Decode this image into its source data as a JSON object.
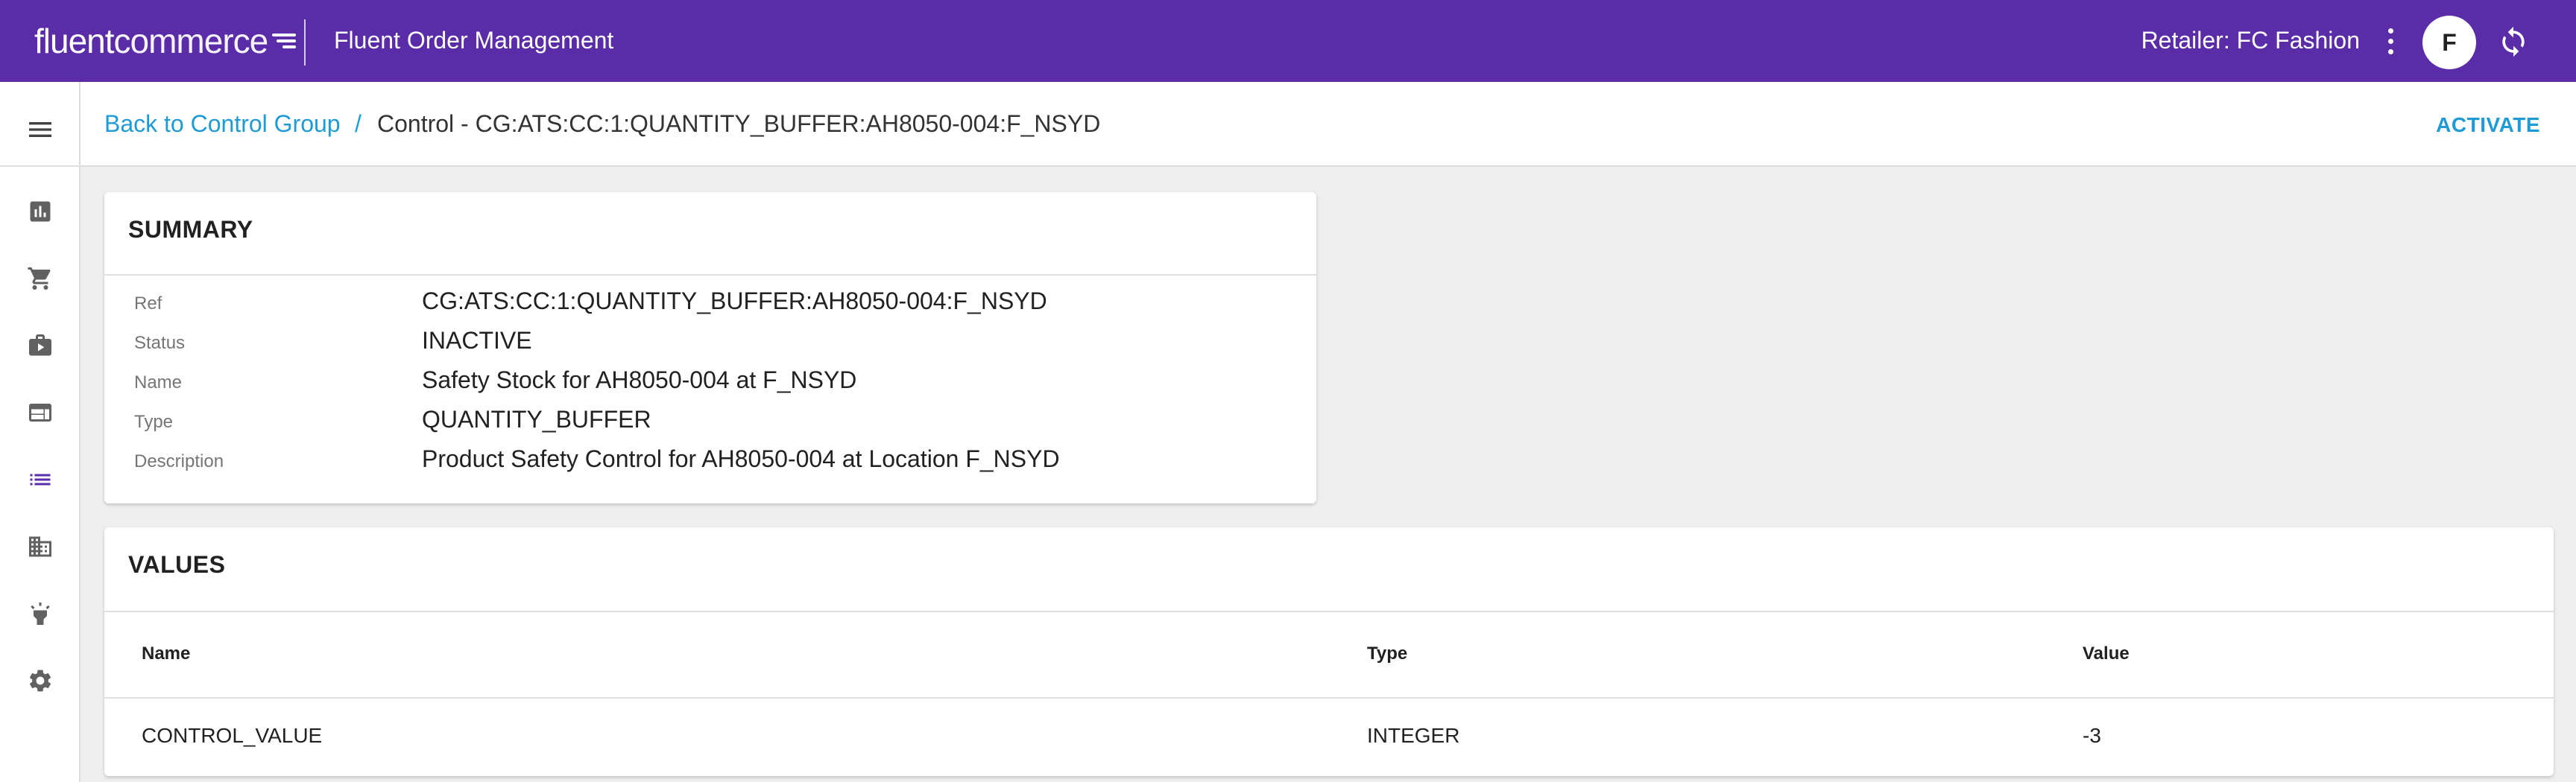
{
  "header": {
    "logo_text_1": "fluent",
    "logo_text_2": "commerce",
    "app_title": "Fluent Order Management",
    "retailer": "Retailer: FC Fashion",
    "avatar_initial": "F",
    "bg_color": "#5a2ca8"
  },
  "sidebar": {
    "items": [
      {
        "icon": "menu-icon"
      },
      {
        "icon": "dashboard-chart-icon"
      },
      {
        "icon": "shopping-cart-icon"
      },
      {
        "icon": "briefcase-icon"
      },
      {
        "icon": "browser-window-icon"
      },
      {
        "icon": "list-icon",
        "active": true
      },
      {
        "icon": "building-icon"
      },
      {
        "icon": "lightbulb-icon"
      },
      {
        "icon": "settings-gear-icon"
      }
    ],
    "active_color": "#5a2ca8"
  },
  "breadcrumb": {
    "back_label": "Back to Control Group",
    "separator": "/",
    "current": "Control - CG:ATS:CC:1:QUANTITY_BUFFER:AH8050-004:F_NSYD",
    "action_label": "ACTIVATE",
    "link_color": "#1e9bd7"
  },
  "summary": {
    "title": "SUMMARY",
    "fields": [
      {
        "label": "Ref",
        "value": "CG:ATS:CC:1:QUANTITY_BUFFER:AH8050-004:F_NSYD"
      },
      {
        "label": "Status",
        "value": "INACTIVE"
      },
      {
        "label": "Name",
        "value": "Safety Stock for AH8050-004 at F_NSYD"
      },
      {
        "label": "Type",
        "value": "QUANTITY_BUFFER"
      },
      {
        "label": "Description",
        "value": "Product Safety Control for AH8050-004 at Location F_NSYD"
      }
    ]
  },
  "values": {
    "title": "VALUES",
    "columns": [
      "Name",
      "Type",
      "Value"
    ],
    "rows": [
      [
        "CONTROL_VALUE",
        "INTEGER",
        "-3"
      ]
    ]
  }
}
